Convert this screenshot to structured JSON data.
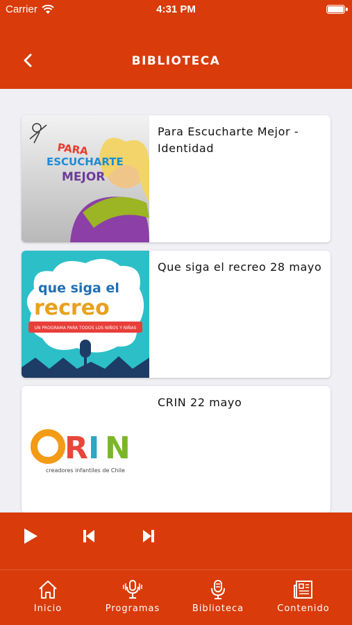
{
  "status_bar": {
    "carrier": "Carrier",
    "time": "4:31 PM"
  },
  "nav": {
    "title": "BIBLIOTECA",
    "back_icon": "chevron-left-icon"
  },
  "items": [
    {
      "title": "Para Escucharte Mejor - Identidad",
      "thumb_text": [
        "PARA",
        "ESCUCHARTE",
        "MEJOR"
      ]
    },
    {
      "title": "Que siga el recreo 28 mayo",
      "thumb_text": [
        "que siga el",
        "recreo",
        "UN PROGRAMA PARA TODOS LOS NIÑOS Y NIÑAS"
      ]
    },
    {
      "title": "CRIN 22 mayo",
      "thumb_text": [
        "CRIN",
        "creadores infantiles de Chile"
      ]
    }
  ],
  "player": {
    "play_icon": "play-icon",
    "prev_icon": "skip-back-icon",
    "next_icon": "skip-forward-icon"
  },
  "tabs": [
    {
      "label": "Inicio",
      "icon": "home-icon"
    },
    {
      "label": "Programas",
      "icon": "podcast-mic-icon"
    },
    {
      "label": "Biblioteca",
      "icon": "microphone-icon"
    },
    {
      "label": "Contenido",
      "icon": "newspaper-icon"
    }
  ],
  "colors": {
    "brand": "#d93b0b",
    "background": "#efeff4",
    "card": "#ffffff"
  }
}
